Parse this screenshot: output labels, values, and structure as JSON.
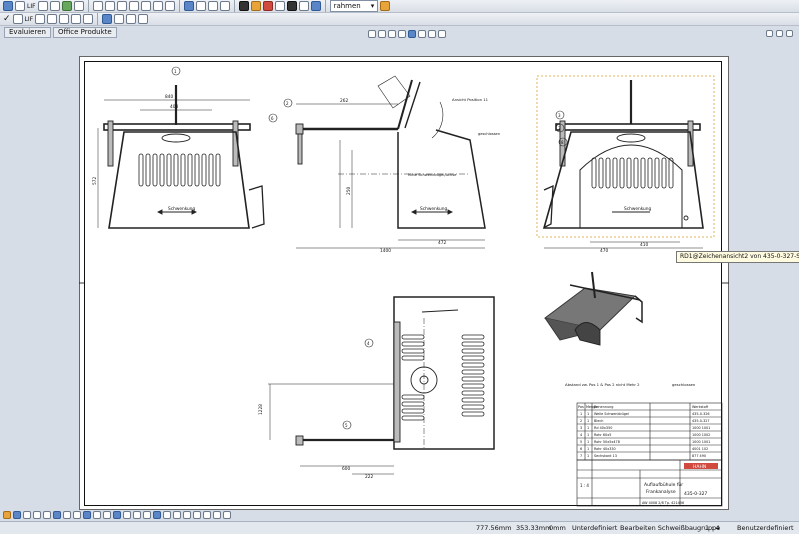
{
  "toolbar1": {
    "labels": [
      "LIF",
      "LIF"
    ],
    "dropdown_value": "rahmen"
  },
  "tabs": [
    {
      "label": "Evaluieren"
    },
    {
      "label": "Office Produkte"
    }
  ],
  "drawing": {
    "section_label": "Ansicht Position 11",
    "center_note": "Mitte Schwenkbügel/Achse",
    "schwenkung_label": "Schwenkung",
    "geschlossen_label": "geschlossen",
    "abstand_note": "Abstand zw. Pos 1 & Pos 2 nicht Mehr 2",
    "geschlossen2_label": "geschlossen",
    "dims": {
      "d840": "840",
      "d408": "408",
      "d1600": "1600",
      "d1400": "1400",
      "d472": "472",
      "d250": "250",
      "d262": "262",
      "d470": "470",
      "d572": "572",
      "d1228": "1228",
      "d600": "600",
      "d222": "222",
      "d410": "410"
    },
    "balloons": {
      "b1": "1",
      "b2": "2",
      "b3": "3",
      "b4": "4",
      "b5": "5",
      "b6": "6",
      "b7": "7",
      "b8": "8"
    }
  },
  "bom": {
    "header": [
      "Pos",
      "Menge",
      "Benennung",
      "Werkstoff"
    ],
    "rows": [
      [
        "1",
        "1",
        "Welle Schwenkbügel",
        "435-0-326"
      ],
      [
        "2",
        "1",
        "Blech",
        "435-0-327"
      ],
      [
        "3",
        "1",
        "Rd 40x350",
        "1000 1001"
      ],
      [
        "4",
        "1",
        "Rohr 60x5",
        "1000 1002"
      ],
      [
        "5",
        "1",
        "Rohr 50x5x478",
        "1000 1001"
      ],
      [
        "6",
        "1",
        "Rohr 40x330",
        "4001 102"
      ],
      [
        "7",
        "1",
        "Sechskant 13",
        "877 490"
      ],
      [
        "8",
        "1",
        "Rd 20x60",
        "1000 1002"
      ]
    ]
  },
  "titleblock": {
    "title1": "Auflaufbühule für",
    "title2": "Frankanalyse",
    "drawing_no": "435-0-327",
    "scale": "1 : 4",
    "logo": "HAHN",
    "small_info": "AW 4008 2/8  Tp. 421456"
  },
  "tooltip": "RD1@Zeichenansicht2 von 435-0-327-Section",
  "status": {
    "x": "777.56mm",
    "y": "353.33mm",
    "z": "0mm",
    "state": "Unterdefiniert",
    "mode": "Bearbeiten Schweißbaugruppe",
    "scale": "1 : 4",
    "user": "Benutzerdefiniert"
  }
}
